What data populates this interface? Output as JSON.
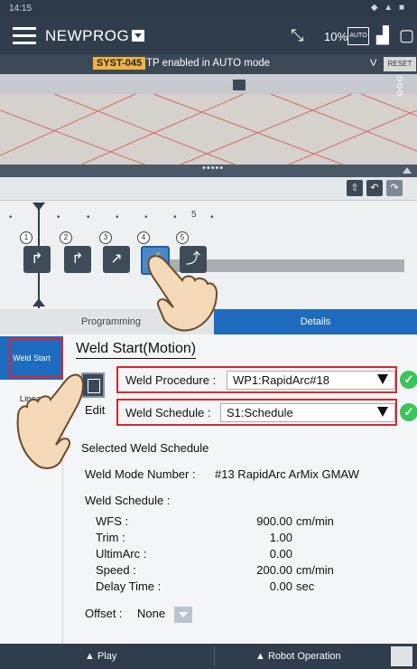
{
  "status_bar": {
    "time": "14:15",
    "icons": "◆ ▲ ■"
  },
  "app_bar": {
    "program_name": "NEWPROG",
    "speed": "10%",
    "auto_badge": "AUTO"
  },
  "alarm": {
    "code": "SYST-045",
    "message": "TP enabled in AUTO mode",
    "expand_glyph": "V",
    "reset_label": "RESET"
  },
  "timeline": {
    "marker": "5",
    "instructions": [
      {
        "num": "1",
        "icon": "arc-start-icon",
        "glyph": "↱"
      },
      {
        "num": "2",
        "icon": "arc-start-icon",
        "glyph": "↱"
      },
      {
        "num": "3",
        "icon": "linear-icon",
        "glyph": "↗"
      },
      {
        "num": "4",
        "icon": "weld-start-icon",
        "glyph": "⚡"
      },
      {
        "num": "5",
        "icon": "weld-end-icon",
        "glyph": "⤴"
      }
    ]
  },
  "tabs": {
    "programming": "Programming",
    "details": "Details"
  },
  "side_nav": {
    "weld_start": "Weld Start",
    "linear": "Linear"
  },
  "details": {
    "title": "Weld Start(Motion)",
    "edit_label": "Edit",
    "weld_procedure_label": "Weld Procedure :",
    "weld_procedure_value": "WP1:RapidArc#18",
    "weld_schedule_label": "Weld Schedule :",
    "weld_schedule_value": "S1:Schedule",
    "selected_heading": "Selected Weld Schedule",
    "weld_mode_label": "Weld Mode Number :",
    "weld_mode_value": "#13 RapidArc ArMix GMAW",
    "weld_schedule_heading": "Weld Schedule :",
    "params": [
      {
        "label": "WFS :",
        "value": "900.00",
        "unit": "cm/min"
      },
      {
        "label": "Trim :",
        "value": "1.00",
        "unit": ""
      },
      {
        "label": "UltimArc :",
        "value": "0.00",
        "unit": ""
      },
      {
        "label": "Speed :",
        "value": "200.00",
        "unit": "cm/min"
      },
      {
        "label": "Delay Time :",
        "value": "0.00",
        "unit": "sec"
      }
    ],
    "offset_label": "Offset :",
    "offset_value": "None"
  },
  "bottom_bar": {
    "play": "▲ Play",
    "robot_operation": "▲ Robot Operation"
  },
  "colors": {
    "accent": "#1e6bc0",
    "highlight": "#d7282f",
    "ok": "#3cc35a",
    "alarm": "#f2b33c"
  }
}
